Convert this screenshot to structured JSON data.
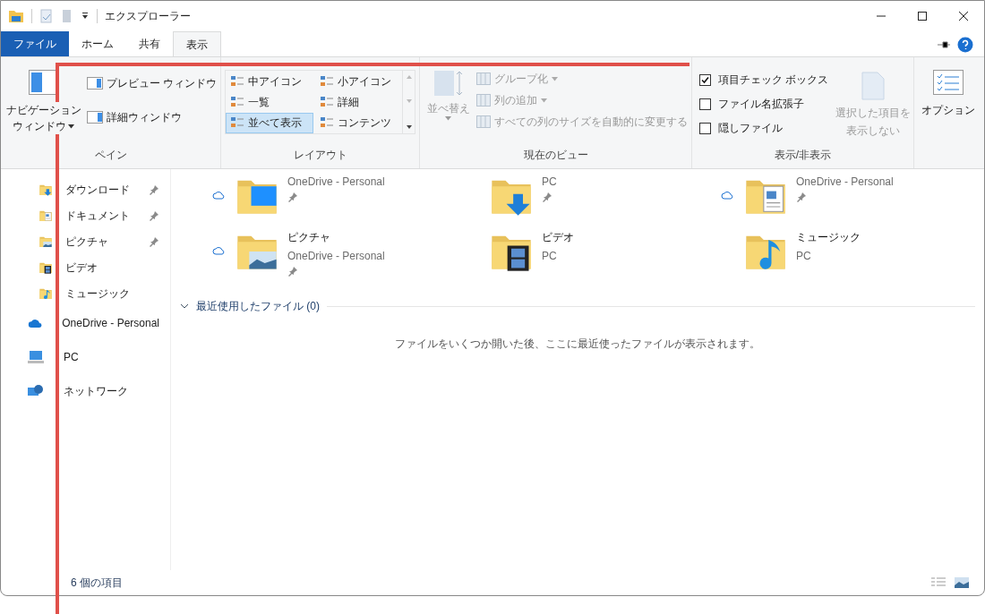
{
  "window": {
    "title": "エクスプローラー"
  },
  "tabs": [
    {
      "label": "ファイル",
      "kind": "file",
      "selected": false
    },
    {
      "label": "ホーム",
      "kind": "tab",
      "selected": false
    },
    {
      "label": "共有",
      "kind": "tab",
      "selected": false
    },
    {
      "label": "表示",
      "kind": "tab",
      "selected": true
    }
  ],
  "pane_group": {
    "label": "ペイン",
    "navigation": [
      "ナビゲーション",
      "ウィンドウ"
    ],
    "buttons": [
      {
        "label": "プレビュー ウィンドウ",
        "kind": "preview"
      },
      {
        "label": "詳細ウィンドウ",
        "kind": "details"
      }
    ]
  },
  "layout_group": {
    "label": "レイアウト",
    "options": [
      {
        "label": "中アイコン",
        "selected": false
      },
      {
        "label": "小アイコン",
        "selected": false
      },
      {
        "label": "一覧",
        "selected": false
      },
      {
        "label": "詳細",
        "selected": false
      },
      {
        "label": "並べて表示",
        "selected": true
      },
      {
        "label": "コンテンツ",
        "selected": false
      }
    ]
  },
  "view_group": {
    "label": "現在のビュー",
    "sort": "並べ替え",
    "items": [
      {
        "label": "グループ化",
        "kind": "group",
        "disabled": true
      },
      {
        "label": "列の追加",
        "kind": "columns",
        "disabled": true
      },
      {
        "label": "すべての列のサイズを自動的に変更する",
        "kind": "resize",
        "disabled": true
      }
    ]
  },
  "show_hide_group": {
    "label": "表示/非表示",
    "checkboxes": [
      {
        "label": "項目チェック ボックス",
        "checked": true
      },
      {
        "label": "ファイル名拡張子",
        "checked": false
      },
      {
        "label": "隠しファイル",
        "checked": false
      }
    ],
    "hide_selected": {
      "lines": [
        "選択した項目を",
        "表示しない"
      ],
      "disabled": true
    }
  },
  "options": {
    "label": "オプション"
  },
  "nav_pane": [
    {
      "label": "ダウンロード",
      "kind": "downloads",
      "pinned": true
    },
    {
      "label": "ドキュメント",
      "kind": "documents",
      "pinned": true
    },
    {
      "label": "ピクチャ",
      "kind": "pictures",
      "pinned": true
    },
    {
      "label": "ビデオ",
      "kind": "videos",
      "pinned": false
    },
    {
      "label": "ミュージック",
      "kind": "music",
      "pinned": false
    },
    {
      "label": "OneDrive - Personal",
      "kind": "onedrive",
      "pinned": false
    },
    {
      "label": "PC",
      "kind": "pc",
      "pinned": false
    },
    {
      "label": "ネットワーク",
      "kind": "network",
      "pinned": false
    }
  ],
  "folders": [
    {
      "kind": "desktop",
      "subtitle": "OneDrive - Personal",
      "cloud": true,
      "pinned": true
    },
    {
      "kind": "downloads",
      "subtitle": "PC",
      "cloud": false,
      "pinned": true
    },
    {
      "kind": "documents",
      "subtitle": "OneDrive - Personal",
      "cloud": true,
      "pinned": true
    },
    {
      "kind": "pictures",
      "name": "ピクチャ",
      "subtitle": "OneDrive - Personal",
      "cloud": true,
      "pinned": true
    },
    {
      "kind": "videos",
      "name": "ビデオ",
      "subtitle": "PC",
      "cloud": false,
      "pinned": false
    },
    {
      "kind": "music",
      "name": "ミュージック",
      "subtitle": "PC",
      "cloud": false,
      "pinned": false
    }
  ],
  "recent": {
    "heading": "最近使用したファイル (0)",
    "expanded": true,
    "empty_message": "ファイルをいくつか開いた後、ここに最近使ったファイルが表示されます。"
  },
  "status_bar": {
    "count": "6 個の項目"
  }
}
